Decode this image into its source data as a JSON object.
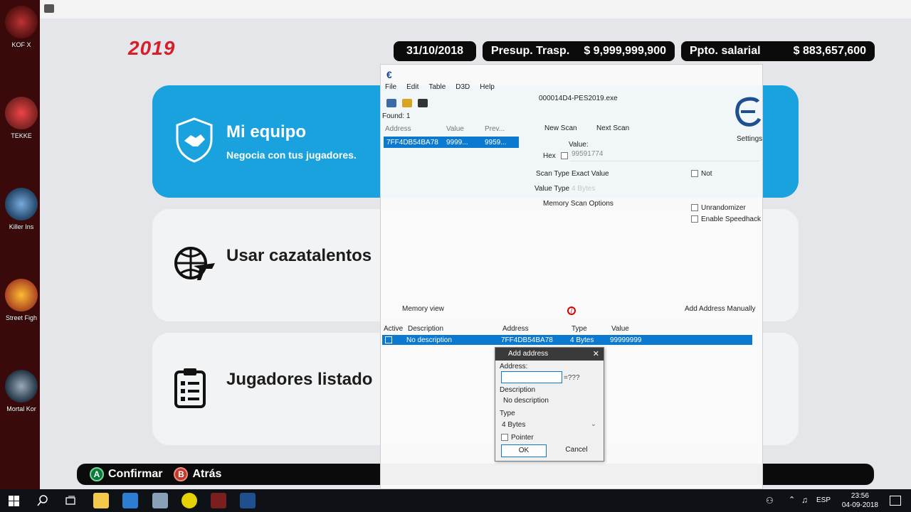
{
  "desktop": {
    "icons": [
      {
        "label": "KOF X"
      },
      {
        "label": "TEKKE"
      },
      {
        "label": "Killer Ins"
      },
      {
        "label": "Street Figh"
      },
      {
        "label": "Mortal Kor"
      }
    ]
  },
  "game": {
    "year": "2019",
    "date": "31/10/2018",
    "transfer_budget_label": "Presup. Trasp.",
    "transfer_budget_value": "$ 9,999,999,900",
    "salary_budget_label": "Ppto. salarial",
    "salary_budget_value": "$ 883,657,600",
    "menu": [
      {
        "title": "Mi equipo",
        "subtitle": "Negocia con tus jugadores."
      },
      {
        "title": "Usar cazatalentos"
      },
      {
        "title": "Jugadores listado"
      }
    ],
    "footer": {
      "a_key": "A",
      "a_label": "Confirmar",
      "b_key": "B",
      "b_label": "Atrás"
    }
  },
  "cheat_engine": {
    "menu": [
      "File",
      "Edit",
      "Table",
      "D3D",
      "Help"
    ],
    "found": "Found: 1",
    "process": "000014D4-PES2019.exe",
    "settings_label": "Settings",
    "results_columns": [
      "Address",
      "Value",
      "Prev..."
    ],
    "results_row": {
      "address": "7FF4DB54BA78",
      "value": "9999...",
      "prev": "9959..."
    },
    "new_scan": "New Scan",
    "next_scan": "Next Scan",
    "value_label": "Value:",
    "hex_label": "Hex",
    "value_input": "99591774",
    "scan_type_label": "Scan Type",
    "scan_type_value": "Exact Value",
    "not_label": "Not",
    "value_type_label": "Value Type",
    "value_type_value": "4 Bytes",
    "memory_scan_options": "Memory Scan Options",
    "unrandomizer": "Unrandomizer",
    "enable_speedhack": "Enable Speedhack",
    "memory_view": "Memory view",
    "add_address_manually": "Add Address Manually",
    "table_columns": [
      "Active",
      "Description",
      "Address",
      "Type",
      "Value"
    ],
    "table_row": {
      "description": "No description",
      "address": "7FF4DB54BA78",
      "type": "4 Bytes",
      "value": "99999999"
    }
  },
  "dialog": {
    "title": "Add address",
    "address_label": "Address:",
    "address_value": "",
    "address_result": "=???",
    "description_label": "Description",
    "description_value": "No description",
    "type_label": "Type",
    "type_value": "4 Bytes",
    "pointer_label": "Pointer",
    "ok": "OK",
    "cancel": "Cancel"
  },
  "taskbar": {
    "language": "ESP",
    "time": "23:56",
    "date": "04-09-2018"
  },
  "colors": {
    "accent_blue": "#1aa2df",
    "year_red": "#d81e2a",
    "selection_blue": "#0b79d0"
  }
}
